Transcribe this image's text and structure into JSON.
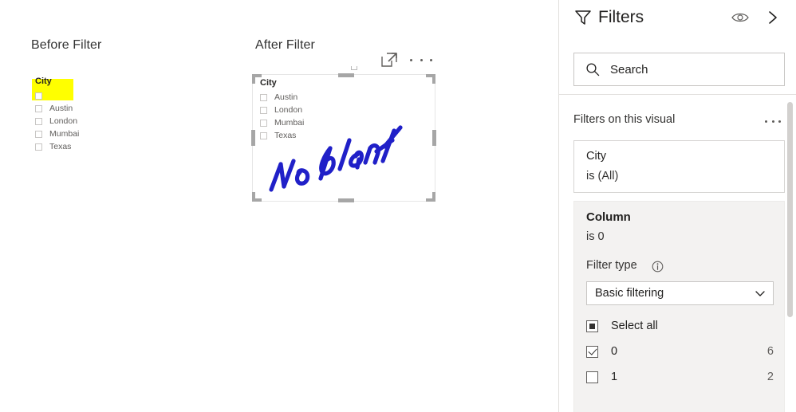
{
  "canvas": {
    "before": {
      "title": "Before Filter",
      "slicer": {
        "header": "City",
        "items": [
          {
            "label": "",
            "checked": false
          },
          {
            "label": "Austin",
            "checked": false
          },
          {
            "label": "London",
            "checked": false
          },
          {
            "label": "Mumbai",
            "checked": false
          },
          {
            "label": "Texas",
            "checked": false
          }
        ],
        "highlight_color": "#ffff00"
      }
    },
    "after": {
      "title": "After Filter",
      "slicer": {
        "header": "City",
        "items": [
          {
            "label": "Austin",
            "checked": false
          },
          {
            "label": "London",
            "checked": false
          },
          {
            "label": "Mumbai",
            "checked": false
          },
          {
            "label": "Texas",
            "checked": false
          }
        ]
      },
      "annotation": {
        "text": "No blank",
        "color": "#2020c8"
      },
      "icons": {
        "focus": "focus-mode-icon",
        "more": "more-options-icon"
      }
    }
  },
  "filters_pane": {
    "title": "Filters",
    "icons": {
      "funnel": "filter-funnel-icon",
      "eye": "hidden-filters-eye-icon",
      "collapse": "chevron-right-icon"
    },
    "search": {
      "placeholder": "Search",
      "icon": "search-icon"
    },
    "visual_filters": {
      "label": "Filters on this visual",
      "more_label": "..."
    },
    "cards": [
      {
        "field": "City",
        "condition": "is (All)",
        "expanded": false
      },
      {
        "field": "Column",
        "condition": "is 0",
        "expanded": true,
        "filter_type_label": "Filter type",
        "filter_type_value": "Basic filtering",
        "options": [
          {
            "label": "Select all",
            "state": "partial",
            "count": ""
          },
          {
            "label": "0",
            "state": "checked",
            "count": "6"
          },
          {
            "label": "1",
            "state": "unchecked",
            "count": "2"
          }
        ]
      }
    ]
  }
}
